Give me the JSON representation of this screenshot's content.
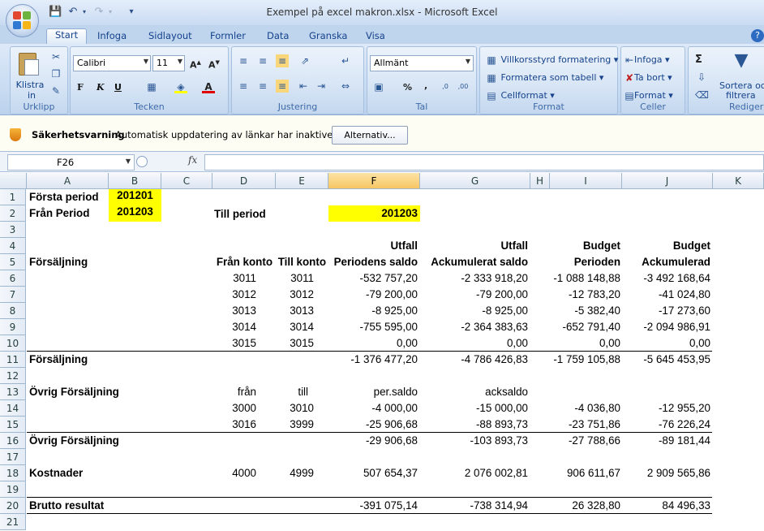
{
  "window": {
    "title": "Exempel på excel makron.xlsx - Microsoft Excel"
  },
  "tabs": [
    "Start",
    "Infoga",
    "Sidlayout",
    "Formler",
    "Data",
    "Granska",
    "Visa"
  ],
  "ribbon": {
    "clipboard": {
      "paste_label": "Klistra",
      "paste_label2": "in",
      "group": "Urklipp"
    },
    "font": {
      "name": "Calibri",
      "size": "11",
      "bold": "F",
      "italic": "K",
      "underline": "U",
      "group": "Tecken"
    },
    "alignment": {
      "group": "Justering"
    },
    "number": {
      "format": "Allmänt",
      "percent": "%",
      "comma": ",",
      "group": "Tal"
    },
    "styles": {
      "conditional": "Villkorsstyrd formatering",
      "table": "Formatera som tabell",
      "cell": "Cellformat",
      "group": "Format"
    },
    "cells": {
      "insert": "Infoga",
      "delete": "Ta bort",
      "format": "Format",
      "group": "Celler"
    },
    "editing": {
      "sigma": "Σ",
      "sort": "Sortera och",
      "sort2": "filtrera",
      "group": "Redigeri"
    }
  },
  "security": {
    "title": "Säkerhetsvarning",
    "message": "Automatisk uppdatering av länkar har inaktiverats",
    "button": "Alternativ..."
  },
  "formula_bar": {
    "name_box": "F26",
    "fx": "fx"
  },
  "columns": [
    "A",
    "B",
    "C",
    "D",
    "E",
    "F",
    "G",
    "H",
    "I",
    "J",
    "K"
  ],
  "rows": [
    "1",
    "2",
    "3",
    "4",
    "5",
    "6",
    "7",
    "8",
    "9",
    "10",
    "11",
    "12",
    "13",
    "14",
    "15",
    "16",
    "17",
    "18",
    "19",
    "20",
    "21"
  ],
  "sheet": {
    "r1": {
      "a": "Första period",
      "b": "201201"
    },
    "r2": {
      "a": "Från Period",
      "b": "201203",
      "d": "Till period",
      "f": "201203"
    },
    "r4": {
      "f": "Utfall",
      "g": "Utfall",
      "i": "Budget",
      "j": "Budget"
    },
    "r5": {
      "a": "Försäljning",
      "d": "Från konto",
      "e": "Till konto",
      "f": "Periodens saldo",
      "g": "Ackumulerat saldo",
      "i": "Perioden",
      "j": "Ackumulerad"
    },
    "r6": {
      "d": "3011",
      "e": "3011",
      "f": "-532 757,20",
      "g": "-2 333 918,20",
      "i": "-1 088 148,88",
      "j": "-3 492 168,64"
    },
    "r7": {
      "d": "3012",
      "e": "3012",
      "f": "-79 200,00",
      "g": "-79 200,00",
      "i": "-12 783,20",
      "j": "-41 024,80"
    },
    "r8": {
      "d": "3013",
      "e": "3013",
      "f": "-8 925,00",
      "g": "-8 925,00",
      "i": "-5 382,40",
      "j": "-17 273,60"
    },
    "r9": {
      "d": "3014",
      "e": "3014",
      "f": "-755 595,00",
      "g": "-2 364 383,63",
      "i": "-652 791,40",
      "j": "-2 094 986,91"
    },
    "r10": {
      "d": "3015",
      "e": "3015",
      "f": "0,00",
      "g": "0,00",
      "i": "0,00",
      "j": "0,00"
    },
    "r11": {
      "a": "Försäljning",
      "f": "-1 376 477,20",
      "g": "-4 786 426,83",
      "i": "-1 759 105,88",
      "j": "-5 645 453,95"
    },
    "r13": {
      "a": "Övrig Försäljning",
      "d": "från",
      "e": "till",
      "f": "per.saldo",
      "g": "acksaldo"
    },
    "r14": {
      "d": "3000",
      "e": "3010",
      "f": "-4 000,00",
      "g": "-15 000,00",
      "i": "-4 036,80",
      "j": "-12 955,20"
    },
    "r15": {
      "d": "3016",
      "e": "3999",
      "f": "-25 906,68",
      "g": "-88 893,73",
      "i": "-23 751,86",
      "j": "-76 226,24"
    },
    "r16": {
      "a": "Övrig Försäljning",
      "f": "-29 906,68",
      "g": "-103 893,73",
      "i": "-27 788,66",
      "j": "-89 181,44"
    },
    "r18": {
      "a": "Kostnader",
      "d": "4000",
      "e": "4999",
      "f": "507 654,37",
      "g": "2 076 002,81",
      "i": "906 611,67",
      "j": "2 909 565,86"
    },
    "r20": {
      "a": "Brutto resultat",
      "f": "-391 075,14",
      "g": "-738 314,94",
      "i": "26 328,80",
      "j": "84 496,33"
    }
  },
  "colors": {
    "highlight": "#ffff00",
    "selected_header": "#f7c663",
    "ribbon": "#c6daf1"
  }
}
